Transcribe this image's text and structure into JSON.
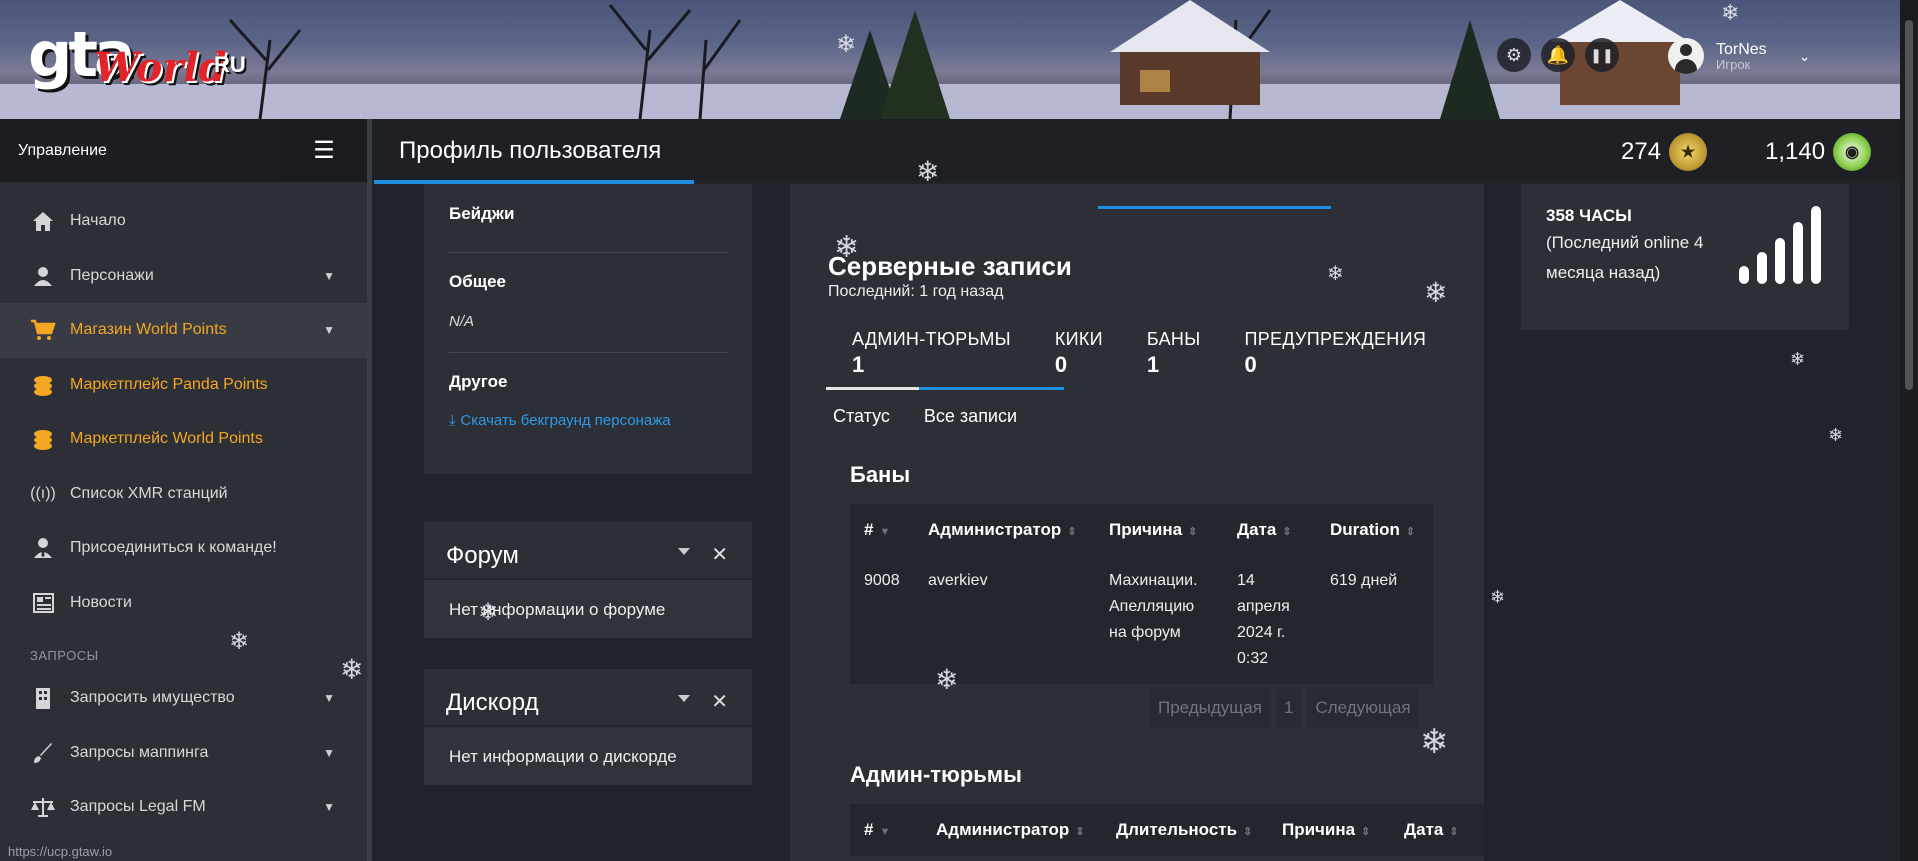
{
  "header": {
    "logo": {
      "gta": "gta",
      "world": "World",
      "ru": "RU"
    },
    "icons": [
      "settings-icon",
      "bell-icon",
      "pause-icon"
    ],
    "user": {
      "name": "TorNes",
      "role": "Игрок"
    }
  },
  "sidebar": {
    "title": "Управление",
    "items": [
      {
        "label": "Начало",
        "icon": "home-icon"
      },
      {
        "label": "Персонажи",
        "icon": "user-icon"
      },
      {
        "label": "Магазин World Points",
        "icon": "cart-icon"
      },
      {
        "label": "Маркетплейс Panda Points",
        "icon": "coins-icon"
      },
      {
        "label": "Маркетплейс World Points",
        "icon": "coins-icon"
      },
      {
        "label": "Список XMR станций",
        "icon": "antenna-icon"
      },
      {
        "label": "Присоединиться к команде!",
        "icon": "user-tie-icon"
      },
      {
        "label": "Новости",
        "icon": "newspaper-icon"
      }
    ],
    "section": "ЗАПРОСЫ",
    "requests": [
      {
        "label": "Запросить имущество",
        "icon": "building-icon"
      },
      {
        "label": "Запросы маппинга",
        "icon": "brush-icon"
      },
      {
        "label": "Запросы Legal FM",
        "icon": "scale-icon"
      }
    ]
  },
  "topbar": {
    "title": "Профиль пользователя",
    "points": "274",
    "panda_points": "1,140"
  },
  "left_card": {
    "badges": "Бейджи",
    "general": "Общее",
    "general_value": "N/A",
    "other": "Другое",
    "download": "Скачать бекграунд персонажа"
  },
  "forum": {
    "title": "Форум",
    "body": "Нет информации о форуме"
  },
  "discord": {
    "title": "Дискорд",
    "body": "Нет информации о дискорде"
  },
  "records": {
    "title": "Серверные записи",
    "last": "Последний: 1 год назад",
    "tabs": [
      {
        "label": "АДМИН-ТЮРЬМЫ",
        "count": "1"
      },
      {
        "label": "КИКИ",
        "count": "0"
      },
      {
        "label": "БАНЫ",
        "count": "1"
      },
      {
        "label": "ПРЕДУПРЕЖДЕНИЯ",
        "count": "0"
      }
    ],
    "subtabs": [
      "Статус",
      "Все записи"
    ],
    "bans": {
      "title": "Баны",
      "columns": [
        "#",
        "Администратор",
        "Причина",
        "Дата",
        "Duration"
      ],
      "rows": [
        {
          "id": "9008",
          "admin": "averkiev",
          "reason": "Махинации. Апелляцию на форум",
          "date": "14 апреля 2024 г. 0:32",
          "duration": "619 дней"
        }
      ],
      "pager": {
        "prev": "Предыдущая",
        "page": "1",
        "next": "Следующая"
      }
    },
    "jails": {
      "title": "Админ-тюрьмы",
      "columns": [
        "#",
        "Администратор",
        "Длительность",
        "Причина",
        "Дата"
      ]
    }
  },
  "playtime": {
    "hours": "358 ЧАСЫ",
    "last_online": "(Последний online 4 месяца назад)"
  },
  "status_url": "https://ucp.gtaw.io"
}
